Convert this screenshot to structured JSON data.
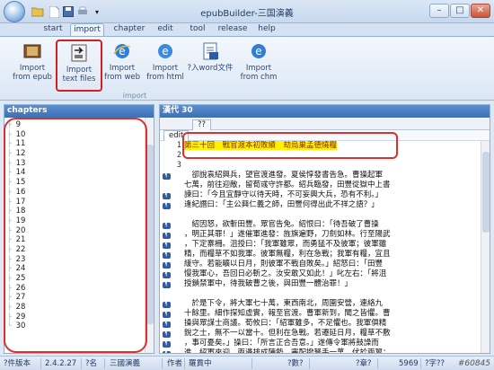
{
  "window": {
    "title": "epubBuilder-三国演義"
  },
  "quick_access": [
    "folder-open-icon",
    "save-icon",
    "new-document-icon",
    "dropdown-icon"
  ],
  "ribbon": {
    "tabs": [
      "start",
      "import",
      "chapter",
      "edit",
      "tool",
      "release",
      "help"
    ],
    "active_tab": "import",
    "group_label": "import",
    "buttons": [
      {
        "line1": "Import",
        "line2": "from epub"
      },
      {
        "line1": "Import",
        "line2": "text files"
      },
      {
        "line1": "Import",
        "line2": "from web"
      },
      {
        "line1": "Import",
        "line2": "from html"
      },
      {
        "line1": "?入word文件",
        "line2": ""
      },
      {
        "line1": "Import",
        "line2": "from chm"
      }
    ]
  },
  "left_panel": {
    "header": "chapters",
    "items": [
      "9",
      "10",
      "11",
      "12",
      "13",
      "14",
      "15",
      "16",
      "17",
      "18",
      "19",
      "20",
      "21",
      "22",
      "23",
      "24",
      "25",
      "26",
      "27",
      "28",
      "29",
      "30"
    ]
  },
  "right_panel": {
    "header": "漢代 30",
    "subtab_label": "??",
    "edit_tab": "edit",
    "lines": [
      {
        "n": "1",
        "text": "第三十回　戰官渡本初敗績　劫烏巢孟德燒糧",
        "icon": false
      },
      {
        "n": "2",
        "text": "",
        "icon": false
      },
      {
        "n": "3",
        "text": "",
        "icon": false
      },
      {
        "n": "",
        "text": "　卻說袁紹興兵，望官渡進發。夏侯惇發書告急。曹操起軍",
        "icon": true
      },
      {
        "n": "",
        "text": "七萬，前往迎敵，留荀彧守許都。紹兵臨發，田豐從獄中上書",
        "icon": false
      },
      {
        "n": "",
        "text": "諫曰：「今且宜靜守以待天時，不可妄興大兵，恐有不利。」",
        "icon": true
      },
      {
        "n": "",
        "text": "逢紀譖曰：「主公興仁義之師，田豐何得出此不祥之語？」",
        "icon": true
      },
      {
        "n": "",
        "text": "",
        "icon": false
      },
      {
        "n": "",
        "text": "　紹因怒，欲斬田豐。眾官告免。紹恨曰：「待吾破了曹操",
        "icon": true
      },
      {
        "n": "",
        "text": "，明正其罪！」遂催軍進發：旌旗遍野，刀劍如林。行至陽武",
        "icon": true
      },
      {
        "n": "",
        "text": "，下定寨柵。沮授曰：「我軍雖眾，而勇猛不及彼軍；彼軍雖",
        "icon": true
      },
      {
        "n": "",
        "text": "精，而糧草不如我軍。彼軍無糧，利在急戰；我軍有糧，宜且",
        "icon": true
      },
      {
        "n": "",
        "text": "緩守。若能曠以日月，則彼軍不戰自敗矣。」紹怒曰：「田豐",
        "icon": true
      },
      {
        "n": "",
        "text": "慢我軍心，吾回日必斬之。汝安敢又如此！」叱左右：「將沮",
        "icon": true
      },
      {
        "n": "",
        "text": "授鎖禁軍中，待我破曹之後，與田豐一體治罪！」",
        "icon": true
      },
      {
        "n": "",
        "text": "",
        "icon": false
      },
      {
        "n": "",
        "text": "　於是下令，將大軍七十萬，東西南北，周圍安營，連絡九",
        "icon": true
      },
      {
        "n": "",
        "text": "十餘里。細作探知虛實，報至官渡。曹軍新到，聞之皆懼。曹",
        "icon": true
      },
      {
        "n": "",
        "text": "操與眾謀士商議。荀攸曰：「紹軍雖多，不足懼也。我軍俱精",
        "icon": true
      },
      {
        "n": "",
        "text": "銳之士，無不一以當十。但利在急戰。若遷延日月，糧草不敷",
        "icon": true
      },
      {
        "n": "",
        "text": "，事可憂矣。」操曰：「所言正合吾意。」遂傳令軍將鼓譟而",
        "icon": true
      },
      {
        "n": "",
        "text": "進。紹軍來迎，兩邊排成陣勢。審配撥弩手一萬，伏於兩翼；",
        "icon": true
      }
    ],
    "last_line": "弓箭手五千，伏於門旗內：約齊砲響，齊發。"
  },
  "status_bar": {
    "cells": [
      "?件版本",
      "2.4.2.27",
      "?名",
      "三國演義",
      "作者",
      "羅貫中",
      "?數?",
      "?章?",
      "5969",
      "?字??"
    ]
  },
  "watermark": "#60845",
  "colors": {
    "accent": "#3d6fb3",
    "highlight": "#fff200",
    "annotation": "#d93030"
  }
}
